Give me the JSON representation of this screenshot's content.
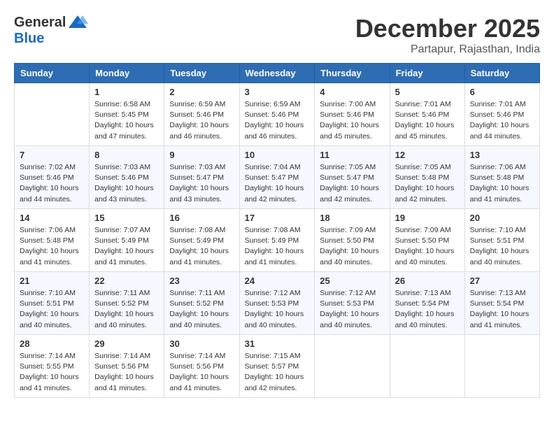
{
  "logo": {
    "general": "General",
    "blue": "Blue"
  },
  "header": {
    "month": "December 2025",
    "location": "Partapur, Rajasthan, India"
  },
  "weekdays": [
    "Sunday",
    "Monday",
    "Tuesday",
    "Wednesday",
    "Thursday",
    "Friday",
    "Saturday"
  ],
  "weeks": [
    [
      {
        "date": "",
        "sunrise": "",
        "sunset": "",
        "daylight": ""
      },
      {
        "date": "1",
        "sunrise": "Sunrise: 6:58 AM",
        "sunset": "Sunset: 5:45 PM",
        "daylight": "Daylight: 10 hours and 47 minutes."
      },
      {
        "date": "2",
        "sunrise": "Sunrise: 6:59 AM",
        "sunset": "Sunset: 5:46 PM",
        "daylight": "Daylight: 10 hours and 46 minutes."
      },
      {
        "date": "3",
        "sunrise": "Sunrise: 6:59 AM",
        "sunset": "Sunset: 5:46 PM",
        "daylight": "Daylight: 10 hours and 46 minutes."
      },
      {
        "date": "4",
        "sunrise": "Sunrise: 7:00 AM",
        "sunset": "Sunset: 5:46 PM",
        "daylight": "Daylight: 10 hours and 45 minutes."
      },
      {
        "date": "5",
        "sunrise": "Sunrise: 7:01 AM",
        "sunset": "Sunset: 5:46 PM",
        "daylight": "Daylight: 10 hours and 45 minutes."
      },
      {
        "date": "6",
        "sunrise": "Sunrise: 7:01 AM",
        "sunset": "Sunset: 5:46 PM",
        "daylight": "Daylight: 10 hours and 44 minutes."
      }
    ],
    [
      {
        "date": "7",
        "sunrise": "Sunrise: 7:02 AM",
        "sunset": "Sunset: 5:46 PM",
        "daylight": "Daylight: 10 hours and 44 minutes."
      },
      {
        "date": "8",
        "sunrise": "Sunrise: 7:03 AM",
        "sunset": "Sunset: 5:46 PM",
        "daylight": "Daylight: 10 hours and 43 minutes."
      },
      {
        "date": "9",
        "sunrise": "Sunrise: 7:03 AM",
        "sunset": "Sunset: 5:47 PM",
        "daylight": "Daylight: 10 hours and 43 minutes."
      },
      {
        "date": "10",
        "sunrise": "Sunrise: 7:04 AM",
        "sunset": "Sunset: 5:47 PM",
        "daylight": "Daylight: 10 hours and 42 minutes."
      },
      {
        "date": "11",
        "sunrise": "Sunrise: 7:05 AM",
        "sunset": "Sunset: 5:47 PM",
        "daylight": "Daylight: 10 hours and 42 minutes."
      },
      {
        "date": "12",
        "sunrise": "Sunrise: 7:05 AM",
        "sunset": "Sunset: 5:48 PM",
        "daylight": "Daylight: 10 hours and 42 minutes."
      },
      {
        "date": "13",
        "sunrise": "Sunrise: 7:06 AM",
        "sunset": "Sunset: 5:48 PM",
        "daylight": "Daylight: 10 hours and 41 minutes."
      }
    ],
    [
      {
        "date": "14",
        "sunrise": "Sunrise: 7:06 AM",
        "sunset": "Sunset: 5:48 PM",
        "daylight": "Daylight: 10 hours and 41 minutes."
      },
      {
        "date": "15",
        "sunrise": "Sunrise: 7:07 AM",
        "sunset": "Sunset: 5:49 PM",
        "daylight": "Daylight: 10 hours and 41 minutes."
      },
      {
        "date": "16",
        "sunrise": "Sunrise: 7:08 AM",
        "sunset": "Sunset: 5:49 PM",
        "daylight": "Daylight: 10 hours and 41 minutes."
      },
      {
        "date": "17",
        "sunrise": "Sunrise: 7:08 AM",
        "sunset": "Sunset: 5:49 PM",
        "daylight": "Daylight: 10 hours and 41 minutes."
      },
      {
        "date": "18",
        "sunrise": "Sunrise: 7:09 AM",
        "sunset": "Sunset: 5:50 PM",
        "daylight": "Daylight: 10 hours and 40 minutes."
      },
      {
        "date": "19",
        "sunrise": "Sunrise: 7:09 AM",
        "sunset": "Sunset: 5:50 PM",
        "daylight": "Daylight: 10 hours and 40 minutes."
      },
      {
        "date": "20",
        "sunrise": "Sunrise: 7:10 AM",
        "sunset": "Sunset: 5:51 PM",
        "daylight": "Daylight: 10 hours and 40 minutes."
      }
    ],
    [
      {
        "date": "21",
        "sunrise": "Sunrise: 7:10 AM",
        "sunset": "Sunset: 5:51 PM",
        "daylight": "Daylight: 10 hours and 40 minutes."
      },
      {
        "date": "22",
        "sunrise": "Sunrise: 7:11 AM",
        "sunset": "Sunset: 5:52 PM",
        "daylight": "Daylight: 10 hours and 40 minutes."
      },
      {
        "date": "23",
        "sunrise": "Sunrise: 7:11 AM",
        "sunset": "Sunset: 5:52 PM",
        "daylight": "Daylight: 10 hours and 40 minutes."
      },
      {
        "date": "24",
        "sunrise": "Sunrise: 7:12 AM",
        "sunset": "Sunset: 5:53 PM",
        "daylight": "Daylight: 10 hours and 40 minutes."
      },
      {
        "date": "25",
        "sunrise": "Sunrise: 7:12 AM",
        "sunset": "Sunset: 5:53 PM",
        "daylight": "Daylight: 10 hours and 40 minutes."
      },
      {
        "date": "26",
        "sunrise": "Sunrise: 7:13 AM",
        "sunset": "Sunset: 5:54 PM",
        "daylight": "Daylight: 10 hours and 40 minutes."
      },
      {
        "date": "27",
        "sunrise": "Sunrise: 7:13 AM",
        "sunset": "Sunset: 5:54 PM",
        "daylight": "Daylight: 10 hours and 41 minutes."
      }
    ],
    [
      {
        "date": "28",
        "sunrise": "Sunrise: 7:14 AM",
        "sunset": "Sunset: 5:55 PM",
        "daylight": "Daylight: 10 hours and 41 minutes."
      },
      {
        "date": "29",
        "sunrise": "Sunrise: 7:14 AM",
        "sunset": "Sunset: 5:56 PM",
        "daylight": "Daylight: 10 hours and 41 minutes."
      },
      {
        "date": "30",
        "sunrise": "Sunrise: 7:14 AM",
        "sunset": "Sunset: 5:56 PM",
        "daylight": "Daylight: 10 hours and 41 minutes."
      },
      {
        "date": "31",
        "sunrise": "Sunrise: 7:15 AM",
        "sunset": "Sunset: 5:57 PM",
        "daylight": "Daylight: 10 hours and 42 minutes."
      },
      {
        "date": "",
        "sunrise": "",
        "sunset": "",
        "daylight": ""
      },
      {
        "date": "",
        "sunrise": "",
        "sunset": "",
        "daylight": ""
      },
      {
        "date": "",
        "sunrise": "",
        "sunset": "",
        "daylight": ""
      }
    ]
  ]
}
